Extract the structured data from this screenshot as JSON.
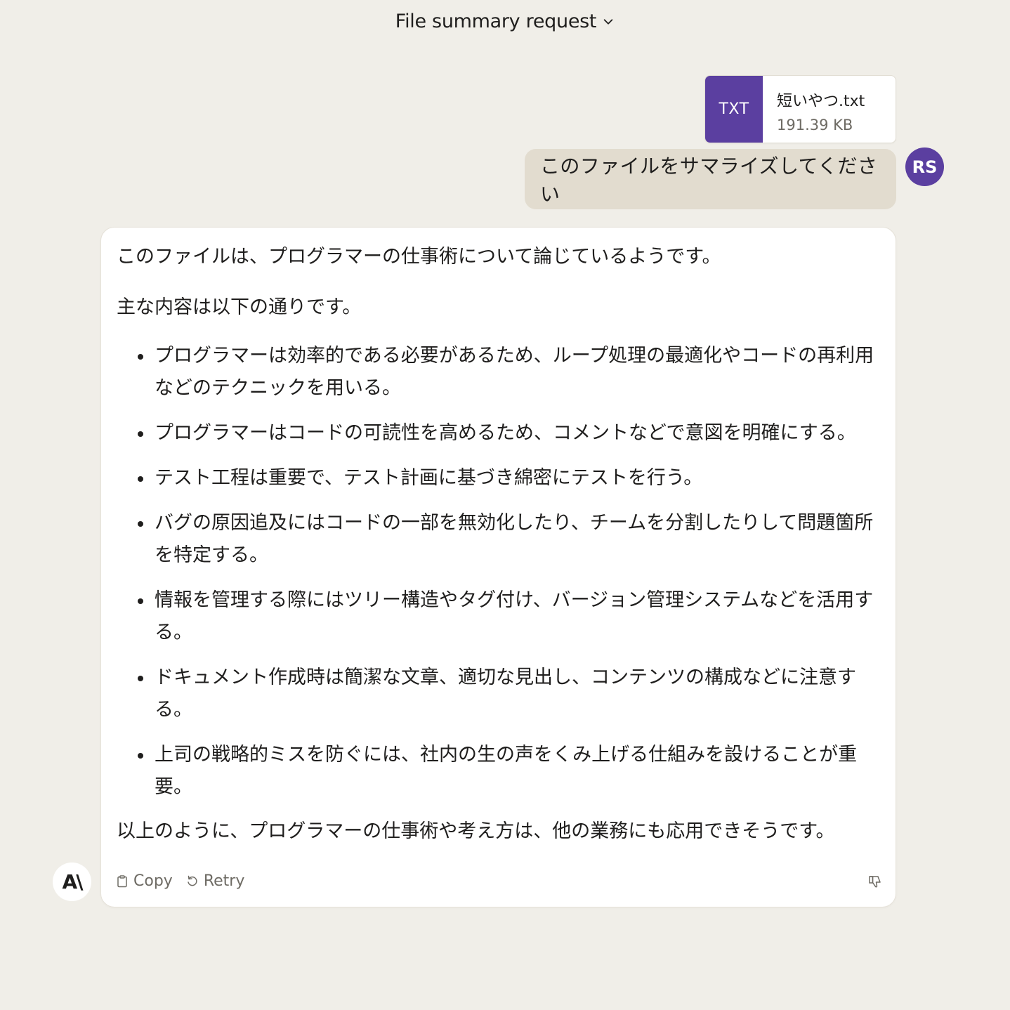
{
  "header": {
    "title": "File summary request"
  },
  "attachment": {
    "type": "TXT",
    "name": "短いやつ.txt",
    "size": "191.39 KB"
  },
  "user": {
    "initials": "RS",
    "message": "このファイルをサマライズしてください"
  },
  "assistant": {
    "logo": "A\\",
    "intro": "このファイルは、プログラマーの仕事術について論じているようです。",
    "lead": "主な内容は以下の通りです。",
    "points": [
      "プログラマーは効率的である必要があるため、ループ処理の最適化やコードの再利用などのテクニックを用いる。",
      "プログラマーはコードの可読性を高めるため、コメントなどで意図を明確にする。",
      "テスト工程は重要で、テスト計画に基づき綿密にテストを行う。",
      "バグの原因追及にはコードの一部を無効化したり、チームを分割したりして問題箇所を特定する。",
      "情報を管理する際にはツリー構造やタグ付け、バージョン管理システムなどを活用する。",
      "ドキュメント作成時は簡潔な文章、適切な見出し、コンテンツの構成などに注意する。",
      "上司の戦略的ミスを防ぐには、社内の生の声をくみ上げる仕組みを設けることが重要。"
    ],
    "conclusion": "以上のように、プログラマーの仕事術や考え方は、他の業務にも応用できそうです。",
    "actions": {
      "copy": "Copy",
      "retry": "Retry"
    }
  }
}
